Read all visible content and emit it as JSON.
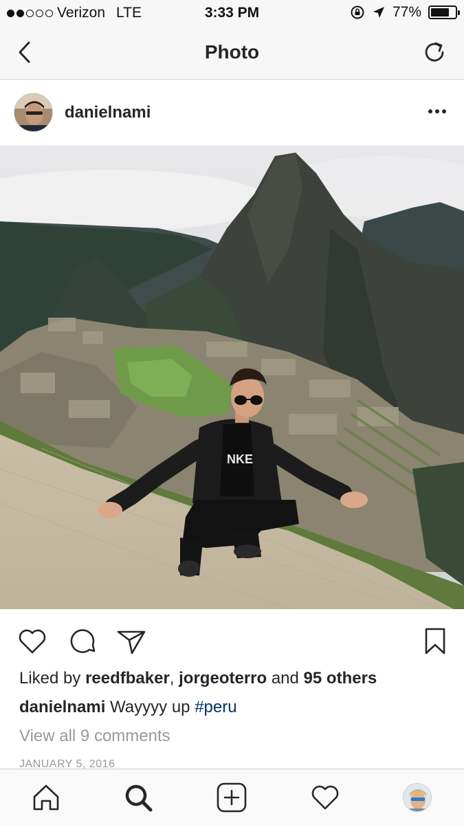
{
  "status_bar": {
    "carrier": "Verizon",
    "network": "LTE",
    "time": "3:33 PM",
    "battery": "77%",
    "battery_level": 0.77,
    "signal_bars_filled": 2,
    "signal_bars_total": 5
  },
  "nav": {
    "title": "Photo",
    "back_icon": "chevron-left-icon",
    "refresh_icon": "refresh-icon"
  },
  "post": {
    "username": "danielnami",
    "more_icon": "ellipsis-icon",
    "likes": {
      "prefix": "Liked by ",
      "user1": "reedfbaker",
      "sep": ", ",
      "user2": "jorgeoterro",
      "and": " and ",
      "others": "95 others"
    },
    "caption": {
      "username": "danielnami",
      "text": " Wayyyy up ",
      "hashtag": "#peru"
    },
    "view_comments": "View all 9 comments",
    "date": "JANUARY 5, 2016"
  },
  "actions": [
    "heart-icon",
    "comment-icon",
    "share-icon",
    "bookmark-icon"
  ],
  "tabbar": [
    "home-icon",
    "search-icon",
    "add-icon",
    "activity-heart-icon",
    "profile-avatar"
  ],
  "colors": {
    "hashtag": "#003569",
    "muted": "#999999",
    "text": "#262626"
  }
}
